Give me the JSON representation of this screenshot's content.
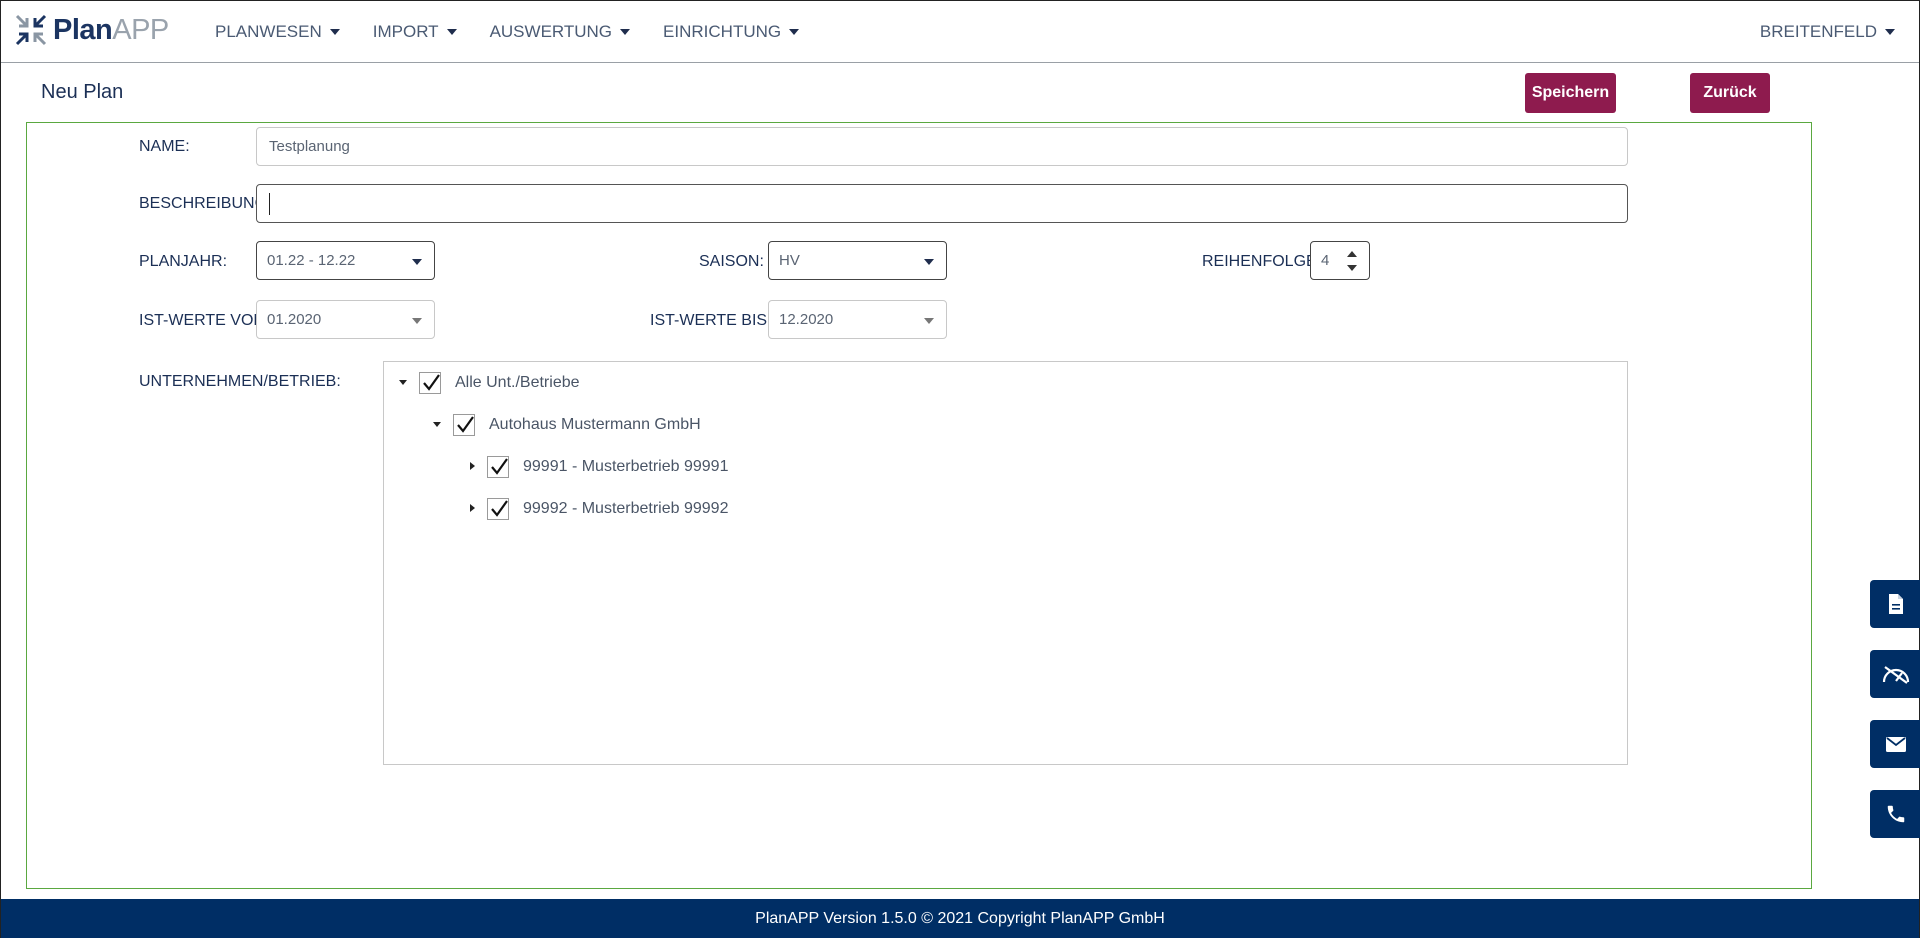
{
  "app": {
    "logo_plan": "Plan",
    "logo_app": "APP"
  },
  "nav": {
    "items": [
      {
        "label": "PLANWESEN"
      },
      {
        "label": "IMPORT"
      },
      {
        "label": "AUSWERTUNG"
      },
      {
        "label": "EINRICHTUNG"
      }
    ],
    "user": "BREITENFELD"
  },
  "page": {
    "title": "Neu Plan",
    "save_label": "Speichern",
    "back_label": "Zurück"
  },
  "form": {
    "name_label": "NAME:",
    "name_value": "Testplanung",
    "beschreibung_label": "BESCHREIBUNG:",
    "beschreibung_value": "",
    "planjahr_label": "PLANJAHR:",
    "planjahr_value": "01.22 - 12.22",
    "saison_label": "SAISON:",
    "saison_value": "HV",
    "reihenfolge_label": "REIHENFOLGE:",
    "reihenfolge_value": "4",
    "ist_von_label": "IST-WERTE VON:",
    "ist_von_value": "01.2020",
    "ist_bis_label": "IST-WERTE BIS:",
    "ist_bis_value": "12.2020",
    "unternehmen_label": "UNTERNEHMEN/BETRIEB:"
  },
  "tree": {
    "nodes": [
      {
        "label": "Alle Unt./Betriebe",
        "checked": true,
        "expanded": true
      },
      {
        "label": "Autohaus Mustermann GmbH",
        "checked": true,
        "expanded": true
      },
      {
        "label": "99991 - Musterbetrieb 99991",
        "checked": true,
        "expanded": false
      },
      {
        "label": "99992 - Musterbetrieb 99992",
        "checked": true,
        "expanded": false
      }
    ]
  },
  "dock": {
    "icons": [
      "document-icon",
      "speedometer-icon",
      "mail-icon",
      "phone-icon"
    ]
  },
  "footer": {
    "text": "PlanAPP Version 1.5.0 © 2021 Copyright PlanAPP GmbH"
  },
  "colors": {
    "primary": "#8e1b4e",
    "navy": "#002e65",
    "panel_border": "#5aa840"
  }
}
